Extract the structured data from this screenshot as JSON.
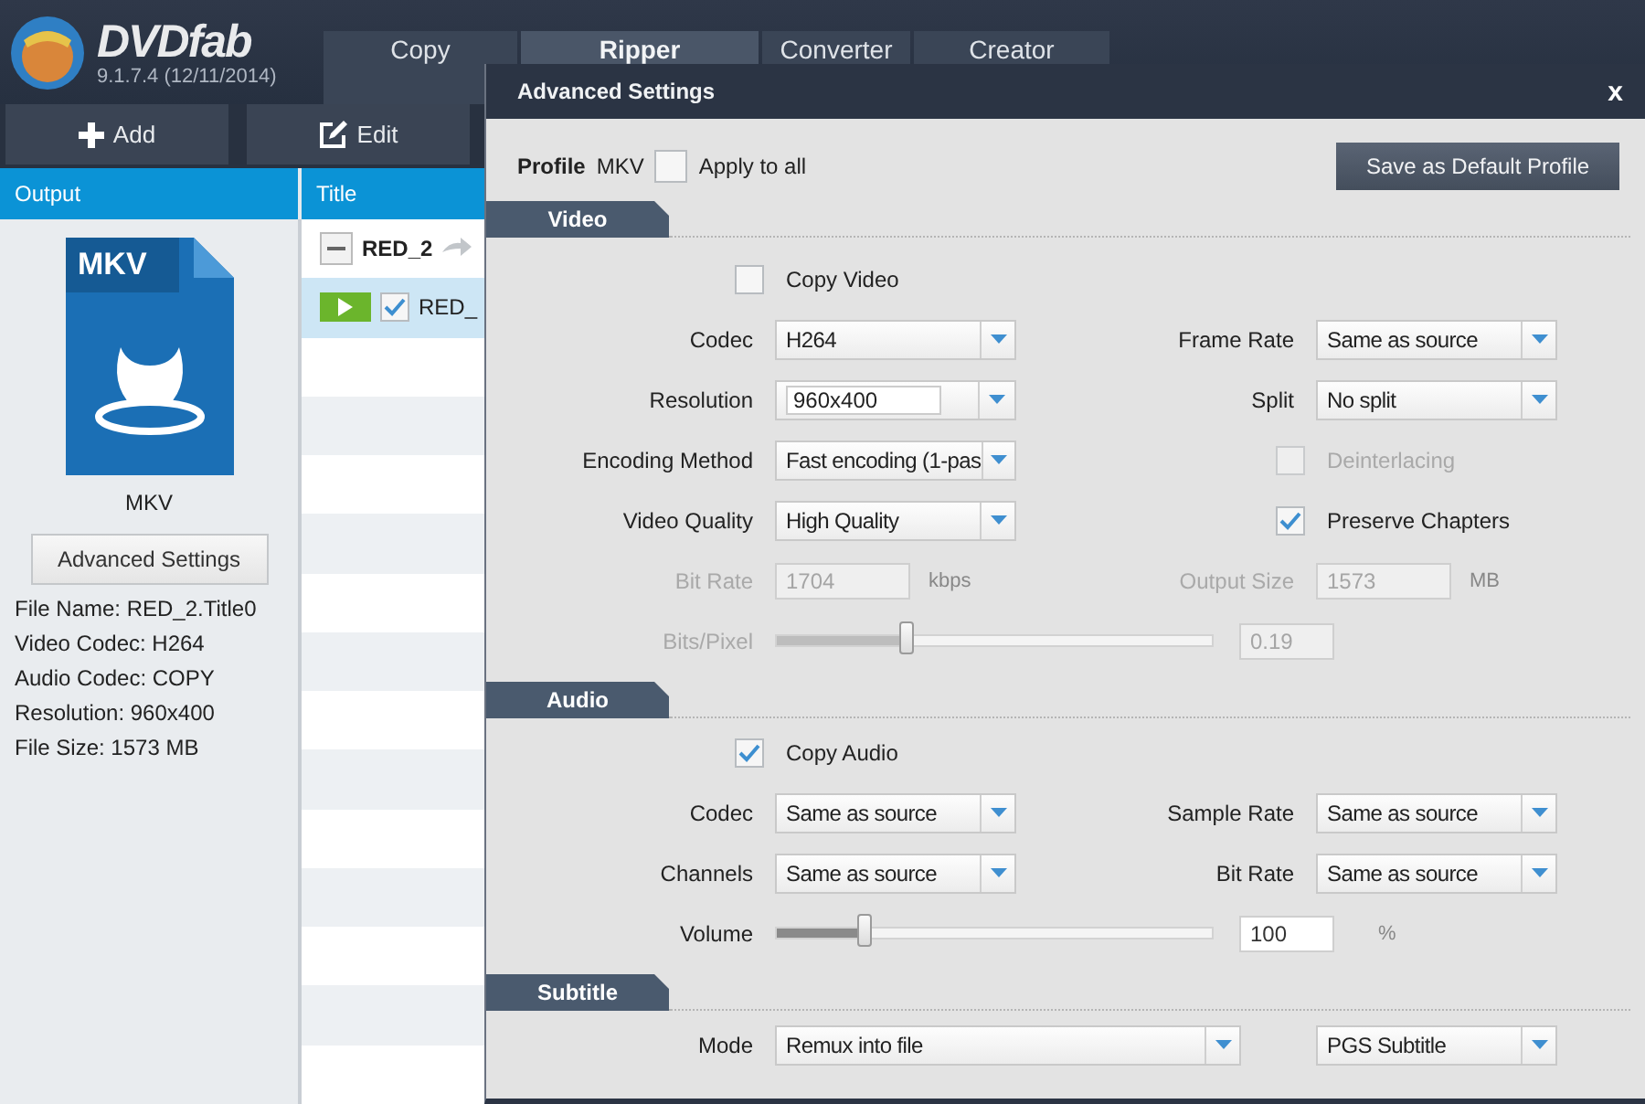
{
  "app": {
    "name": "DVDfab",
    "version": "9.1.7.4 (12/11/2014)"
  },
  "tabs": [
    {
      "label": "Copy",
      "selected": false
    },
    {
      "label": "Ripper",
      "selected": true
    },
    {
      "label": "Converter",
      "selected": false
    },
    {
      "label": "Creator",
      "selected": false
    }
  ],
  "toolbar": [
    {
      "label": "Add",
      "kind": "add"
    },
    {
      "label": "Edit",
      "kind": "edit"
    }
  ],
  "columns": [
    "Output",
    "Title"
  ],
  "output": {
    "icon_label": "MKV",
    "format": "MKV",
    "button": "Advanced Settings",
    "info": [
      "File Name: RED_2.Title0",
      "Video Codec: H264",
      "Audio Codec: COPY",
      "Resolution: 960x400",
      "File Size: 1573 MB"
    ]
  },
  "titles": [
    {
      "kind": "group",
      "label": "RED_2",
      "expanded": true,
      "selected": false
    },
    {
      "kind": "title",
      "label": "RED_",
      "checked": true,
      "selected": true
    }
  ],
  "dialog": {
    "title": "Advanced Settings",
    "close": "x",
    "profile": {
      "label": "Profile",
      "value": "MKV",
      "apply": {
        "label": "Apply to all",
        "checked": false
      },
      "save_button": "Save as Default Profile"
    },
    "sections": [
      {
        "title": "Video",
        "rows": [
          [
            {
              "kind": "checkbox",
              "label": "Copy Video",
              "checked": false,
              "disabled": false
            }
          ],
          [
            {
              "kind": "select",
              "label": "Codec",
              "value": "H264",
              "disabled": false
            },
            {
              "kind": "select",
              "label": "Frame Rate",
              "value": "Same as source",
              "disabled": false
            }
          ],
          [
            {
              "kind": "combo",
              "label": "Resolution",
              "value": "960x400",
              "disabled": false
            },
            {
              "kind": "select",
              "label": "Split",
              "value": "No split",
              "disabled": false
            }
          ],
          [
            {
              "kind": "select",
              "label": "Encoding Method",
              "value": "Fast encoding (1-pas",
              "disabled": false
            },
            {
              "kind": "checkbox",
              "label": "Deinterlacing",
              "checked": false,
              "disabled": true
            }
          ],
          [
            {
              "kind": "select",
              "label": "Video Quality",
              "value": "High Quality",
              "disabled": false
            },
            {
              "kind": "checkbox",
              "label": "Preserve Chapters",
              "checked": true,
              "disabled": false
            }
          ],
          [
            {
              "kind": "input",
              "label": "Bit Rate",
              "value": "1704",
              "unit": "kbps",
              "disabled": true
            },
            {
              "kind": "input",
              "label": "Output Size",
              "value": "1573",
              "unit": "MB",
              "disabled": true
            }
          ],
          [
            {
              "kind": "slider",
              "label": "Bits/Pixel",
              "level": 0.3,
              "value": "0.19",
              "disabled": true
            }
          ]
        ]
      },
      {
        "title": "Audio",
        "rows": [
          [
            {
              "kind": "checkbox",
              "label": "Copy Audio",
              "checked": true,
              "disabled": false
            }
          ],
          [
            {
              "kind": "select",
              "label": "Codec",
              "value": "Same as source",
              "disabled": false
            },
            {
              "kind": "select",
              "label": "Sample Rate",
              "value": "Same as source",
              "disabled": false
            }
          ],
          [
            {
              "kind": "select",
              "label": "Channels",
              "value": "Same as source",
              "disabled": false
            },
            {
              "kind": "select",
              "label": "Bit Rate",
              "value": "Same as source",
              "disabled": false
            }
          ],
          [
            {
              "kind": "slider",
              "label": "Volume",
              "level": 0.2,
              "value": "100",
              "unit": "%",
              "disabled": false
            }
          ]
        ]
      },
      {
        "title": "Subtitle",
        "rows": [
          [
            {
              "kind": "wide-select",
              "label": "Mode",
              "value": "Remux into file",
              "disabled": false
            },
            {
              "kind": "select",
              "value": "PGS Subtitle",
              "disabled": false
            }
          ]
        ]
      }
    ]
  }
}
